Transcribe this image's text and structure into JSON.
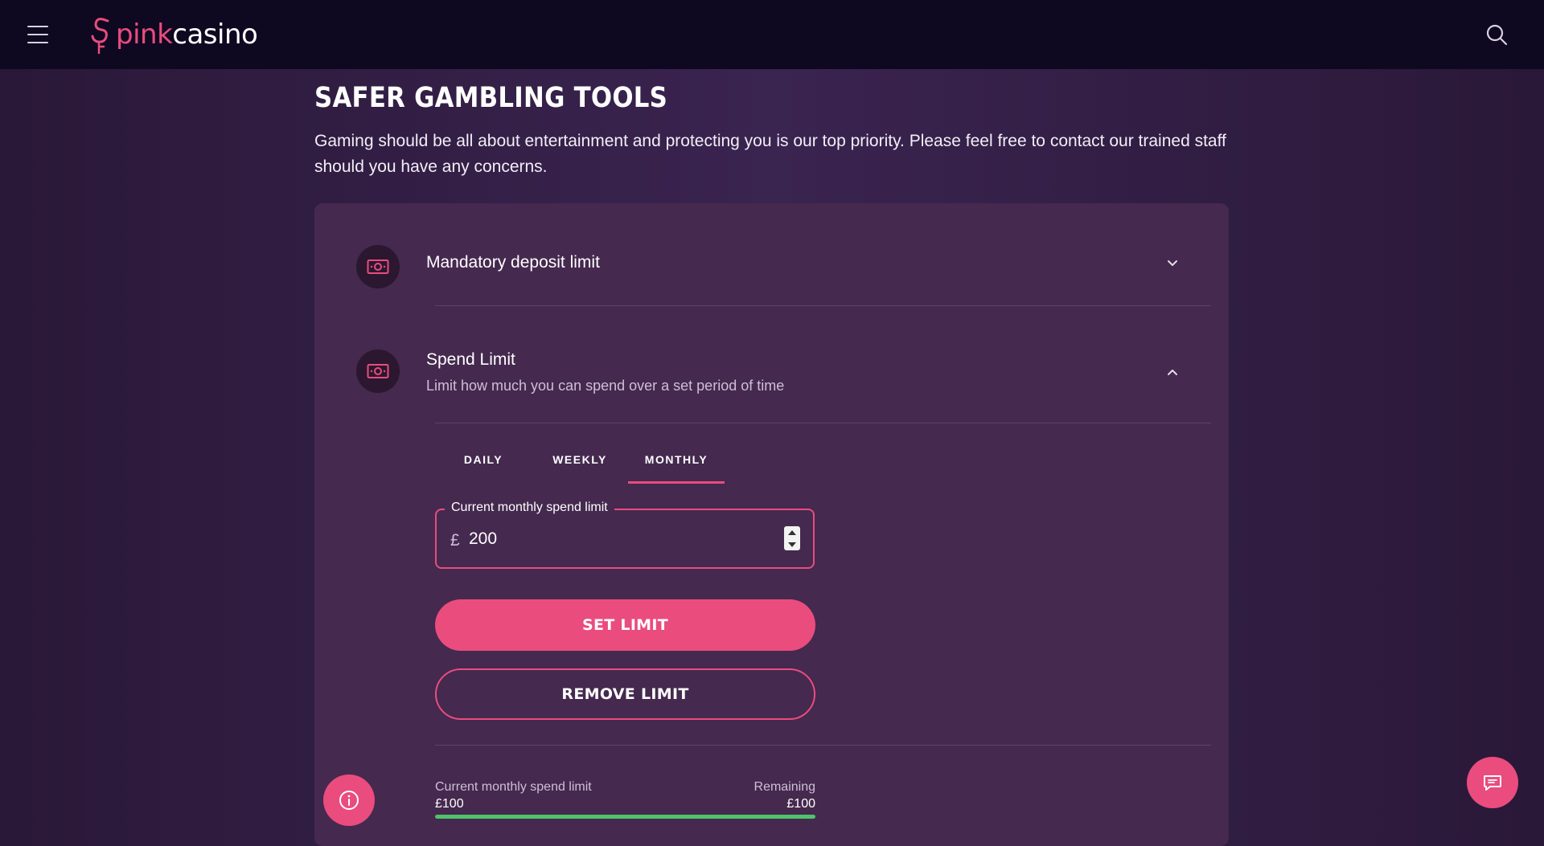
{
  "header": {
    "logo_pink": "pink",
    "logo_white": "casino",
    "menu_icon": "hamburger-menu-icon",
    "search_icon": "search-icon"
  },
  "page": {
    "title": "SAFER GAMBLING TOOLS",
    "intro": "Gaming should be all about entertainment and protecting you is our top priority. Please feel free to contact our trained staff should you have any concerns."
  },
  "deposit_limit": {
    "title": "Mandatory deposit limit",
    "icon": "cash-icon",
    "expanded": false
  },
  "spend_limit": {
    "title": "Spend Limit",
    "subtitle": "Limit how much you can spend over a set period of time",
    "icon": "cash-icon",
    "expanded": true,
    "tabs": [
      {
        "label": "DAILY",
        "active": false
      },
      {
        "label": "WEEKLY",
        "active": false
      },
      {
        "label": "MONTHLY",
        "active": true
      }
    ],
    "field_label": "Current monthly spend limit",
    "currency": "£",
    "value": "200",
    "set_button": "SET LIMIT",
    "remove_button": "REMOVE LIMIT",
    "summary": {
      "left_label": "Current monthly spend limit",
      "left_value": "£100",
      "right_label": "Remaining",
      "right_value": "£100",
      "remaining_fraction": 1.0
    }
  },
  "colors": {
    "accent": "#ea4c7e",
    "topbar": "#0e0820",
    "card": "#45294f",
    "progress": "#4ec46a"
  },
  "fabs": {
    "info_icon": "info-icon",
    "chat_icon": "chat-icon"
  }
}
